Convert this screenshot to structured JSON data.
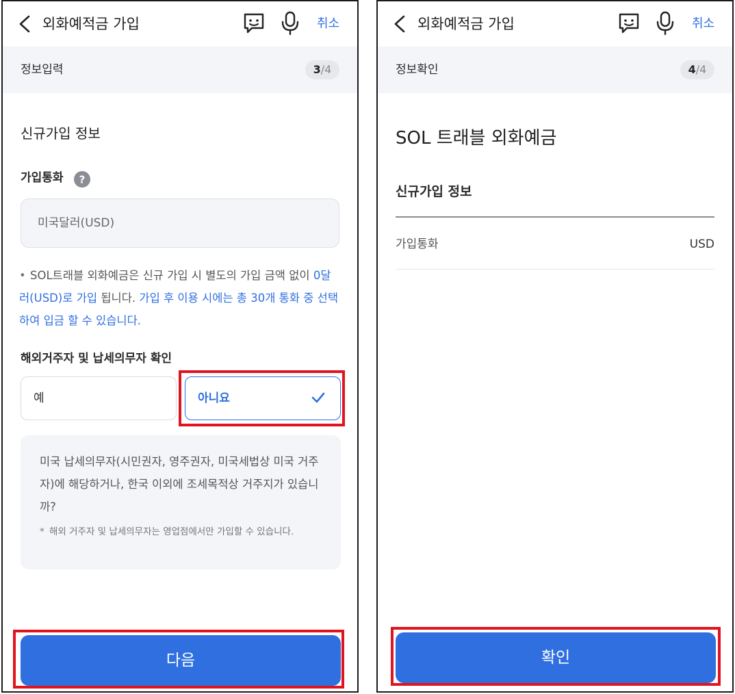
{
  "left": {
    "header": {
      "title": "외화예적금 가입",
      "cancel_label": "취소"
    },
    "step": {
      "title": "정보입력",
      "current": "3",
      "total": "4"
    },
    "section_title": "신규가입 정보",
    "currency": {
      "label": "가입통화",
      "value": "미국달러(USD)"
    },
    "note": {
      "part1": "SOL트래블 외화예금은 신규 가입 시 별도의 가입 금액 없이 ",
      "part2_blue": "0달러(USD)로 가입",
      "part3": " 됩니다. ",
      "part4_blue": "가입 후 이용 시에는 총 30개 통화 중 선택하여 입금 할 수 있습니다."
    },
    "residency": {
      "label": "해외거주자 및 납세의무자 확인",
      "yes_label": "예",
      "no_label": "아니요"
    },
    "info": {
      "question": "미국 납세의무자(시민권자, 영주권자, 미국세법상 미국 거주자)에 해당하거나, 한국 이외에 조세목적상 거주지가 있습니까?",
      "footnote": "해외 거주자 및 납세의무자는 영업점에서만 가입할 수 있습니다."
    },
    "next_label": "다음"
  },
  "right": {
    "header": {
      "title": "외화예적금 가입",
      "cancel_label": "취소"
    },
    "step": {
      "title": "정보확인",
      "current": "4",
      "total": "4"
    },
    "product_title": "SOL 트래블 외화예금",
    "section_title": "신규가입 정보",
    "currency_row": {
      "label": "가입통화",
      "value": "USD"
    },
    "confirm_label": "확인"
  },
  "colors": {
    "accent": "#2f6fe0",
    "highlight": "#e0141e",
    "panel_bg": "#f4f5f9"
  },
  "icons": [
    "back-chevron-icon",
    "chat-bubble-icon",
    "microphone-icon",
    "help-question-icon",
    "checkmark-icon"
  ]
}
